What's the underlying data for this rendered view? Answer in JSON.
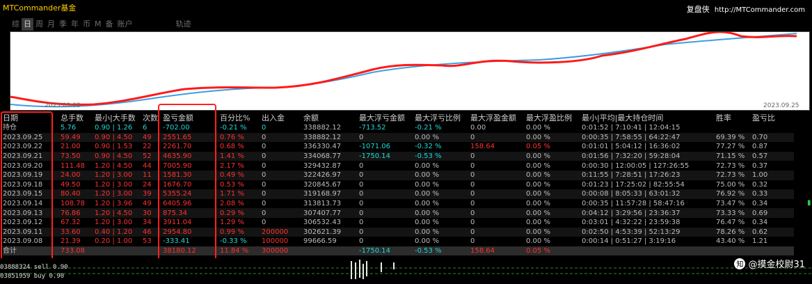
{
  "app": {
    "title": "MTCommander基金",
    "brand_cn": "复盘侠",
    "brand_url": "http://MTCommander.com"
  },
  "tabs": [
    "综",
    "日",
    "周",
    "月",
    "季",
    "年",
    "币",
    "M",
    "备",
    "账户",
    "轨迹"
  ],
  "active_tab": "日",
  "chart_dates": {
    "from": "2023.09.08",
    "to": "2023.09.25"
  },
  "table": {
    "headers": [
      "日期",
      "总手数",
      "最小|大手数",
      "次数",
      "盈亏金额",
      "百分比%",
      "出入金",
      "余额",
      "最大浮亏金额",
      "最大浮亏比例",
      "最大浮盈金额",
      "最大浮盈比例",
      "最小|平均|最大持仓时间",
      "胜率",
      "盈亏比"
    ],
    "hold": [
      "持仓",
      "5.76",
      "0.90 | 1.26",
      "6",
      "-702.00",
      "-0.21 %",
      "0",
      "338882.12",
      "-713.52",
      "-0.21 %",
      "0.00",
      "0.00 %",
      "0:01:52 | 7:10:41 | 12:04:15",
      "",
      ""
    ],
    "rows": [
      [
        "2023.09.25",
        "59.49",
        "0.90 | 4.50",
        "49",
        "2551.65",
        "0.76 %",
        "0",
        "338882.12",
        "0",
        "0.00 %",
        "0",
        "0.00 %",
        "0:00:35 | 7:58:55 | 64:22:47",
        "69.39 %",
        "0.70"
      ],
      [
        "2023.09.22",
        "21.00",
        "0.90 | 1.53",
        "22",
        "2261.70",
        "0.68 %",
        "0",
        "336330.47",
        "-1071.06",
        "-0.32 %",
        "158.64",
        "0.05 %",
        "0:01:01 | 5:04:12 | 16:36:02",
        "77.27 %",
        "0.87"
      ],
      [
        "2023.09.21",
        "73.50",
        "0.90 | 4.50",
        "52",
        "4635.90",
        "1.41 %",
        "0",
        "334068.77",
        "-1750.14",
        "-0.53 %",
        "0",
        "0.00 %",
        "0:01:56 | 7:32:20 | 59:28:04",
        "71.15 %",
        "0.57"
      ],
      [
        "2023.09.20",
        "111.48",
        "1.20 | 4.50",
        "44",
        "7005.90",
        "2.17 %",
        "0",
        "329432.87",
        "0",
        "0.00 %",
        "0",
        "0.00 %",
        "0:00:30 | 12:00:05 | 127:26:55",
        "72.73 %",
        "0.37"
      ],
      [
        "2023.09.19",
        "24.00",
        "1.20 | 3.00",
        "11",
        "1581.30",
        "0.49 %",
        "0",
        "322426.97",
        "0",
        "0.00 %",
        "0",
        "0.00 %",
        "0:11:55 | 7:28:51 | 17:26:23",
        "72.73 %",
        "1.00"
      ],
      [
        "2023.09.18",
        "49.50",
        "1.20 | 3.00",
        "24",
        "1676.70",
        "0.53 %",
        "0",
        "320845.67",
        "0",
        "0.00 %",
        "0",
        "0.00 %",
        "0:01:23 | 17:25:02 | 82:55:54",
        "75.00 %",
        "0.32"
      ],
      [
        "2023.09.15",
        "80.40",
        "1.20 | 3.00",
        "39",
        "5355.24",
        "1.71 %",
        "0",
        "319168.97",
        "0",
        "0.00 %",
        "0",
        "0.00 %",
        "0:00:08 | 8:05:33 | 63:01:32",
        "76.92 %",
        "0.33"
      ],
      [
        "2023.09.14",
        "108.78",
        "1.20 | 3.96",
        "49",
        "6405.96",
        "2.08 %",
        "0",
        "313813.73",
        "0",
        "0.00 %",
        "0",
        "0.00 %",
        "0:00:35 | 11:57:28 | 58:47:16",
        "73.47 %",
        "0.34"
      ],
      [
        "2023.09.13",
        "76.86",
        "1.20 | 4.50",
        "30",
        "875.34",
        "0.29 %",
        "0",
        "307407.77",
        "0",
        "0.00 %",
        "0",
        "0.00 %",
        "0:04:12 | 3:29:56 | 23:36:37",
        "73.33 %",
        "0.69"
      ],
      [
        "2023.09.12",
        "67.32",
        "1.20 | 3.00",
        "34",
        "3911.04",
        "1.29 %",
        "0",
        "306532.43",
        "0",
        "0.00 %",
        "0",
        "0.00 %",
        "0:03:01 | 4:32:22 | 23:59:38",
        "76.47 %",
        "0.34"
      ],
      [
        "2023.09.11",
        "33.60",
        "0.40 | 1.20",
        "46",
        "2954.80",
        "0.99 %",
        "200000",
        "302621.39",
        "0",
        "0.00 %",
        "0",
        "0.00 %",
        "0:02:50 | 4:53:39 | 52:13:29",
        "78.26 %",
        "0.62"
      ],
      [
        "2023.09.08",
        "21.39",
        "0.20 | 1.00",
        "53",
        "-333.41",
        "-0.33 %",
        "100000",
        "99666.59",
        "0",
        "0.00 %",
        "0",
        "0.00 %",
        "0:00:14 | 0:51:27 | 3:19:16",
        "43.40 %",
        "1.21"
      ]
    ],
    "total": [
      "合计",
      "733.08",
      "",
      "",
      "38180.12",
      "11.84 %",
      "300000",
      "",
      "-1750.14",
      "-0.53 %",
      "158.64",
      "0.05 %",
      "",
      "",
      ""
    ]
  },
  "bottom": {
    "tick1": "03888324 sell 0.90",
    "tick2": "03851959 buy 0.90",
    "watermark": "@摸金校尉31"
  },
  "colors": {
    "profit": "#ff3030",
    "neutral": "#1fd8d8",
    "highlight_box": "#ff2020",
    "title": "#ffd000"
  }
}
